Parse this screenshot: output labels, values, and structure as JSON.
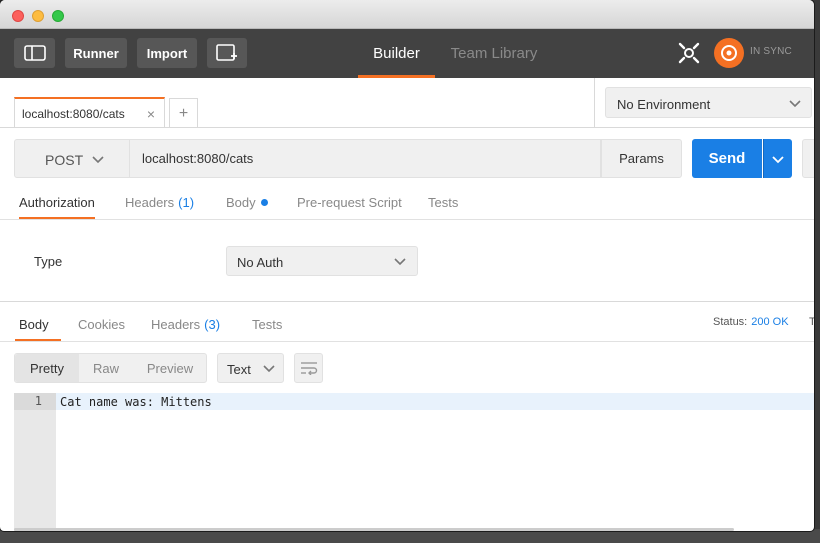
{
  "header": {
    "runner_label": "Runner",
    "import_label": "Import",
    "tabs": [
      {
        "label": "Builder",
        "active": true
      },
      {
        "label": "Team Library",
        "active": false
      }
    ],
    "sync_text": "IN SYNC"
  },
  "request_tab": {
    "label": "localhost:8080/cats",
    "close": "×",
    "add": "+"
  },
  "environment": {
    "selected": "No Environment"
  },
  "request": {
    "method": "POST",
    "url": "localhost:8080/cats",
    "params_label": "Params",
    "send_label": "Send"
  },
  "request_tabs": {
    "authorization": "Authorization",
    "headers": "Headers",
    "headers_count": "(1)",
    "body": "Body",
    "prerequest": "Pre-request Script",
    "tests": "Tests"
  },
  "auth": {
    "type_label": "Type",
    "selected": "No Auth"
  },
  "response_tabs": {
    "body": "Body",
    "cookies": "Cookies",
    "headers": "Headers",
    "headers_count": "(3)",
    "tests": "Tests"
  },
  "status": {
    "label": "Status:",
    "value": "200 OK",
    "time_label": "T"
  },
  "view": {
    "pretty": "Pretty",
    "raw": "Raw",
    "preview": "Preview",
    "format": "Text"
  },
  "code": {
    "line_number": "1",
    "text": "Cat name was: Mittens"
  },
  "colors": {
    "accent": "#f47023",
    "send": "#1a7fe5",
    "header_bg": "#424242"
  }
}
